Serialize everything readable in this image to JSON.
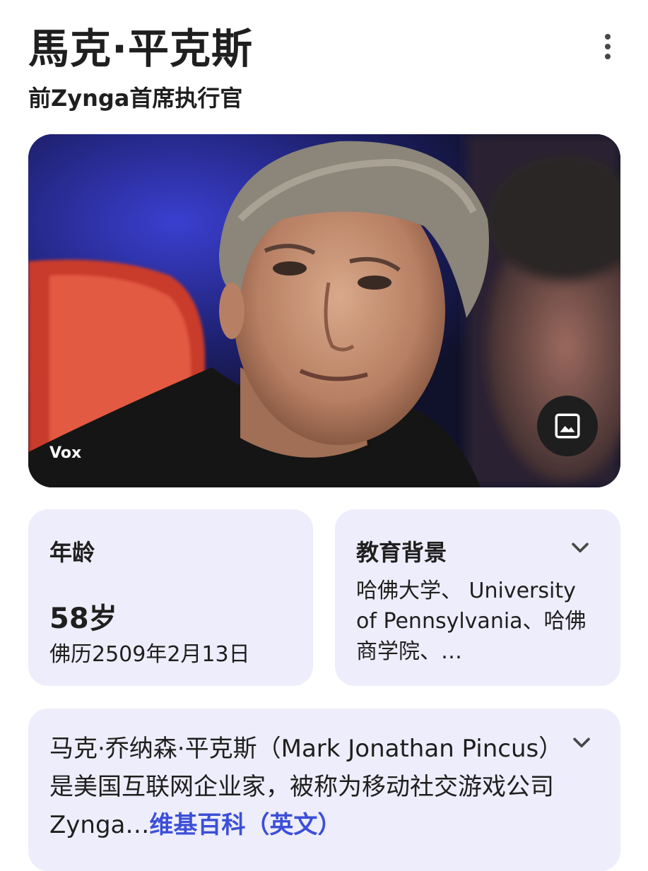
{
  "header": {
    "title": "馬克·平克斯",
    "subtitle": "前Zynga首席执行官",
    "more_icon": "more-vert-icon"
  },
  "hero": {
    "source": "Vox",
    "image_button_icon": "image-icon"
  },
  "age_card": {
    "label": "年龄",
    "value": "58岁",
    "date": "佛历2509年2月13日"
  },
  "education_card": {
    "label": "教育背景",
    "text": "哈佛大学、 University of Pennsylvania、哈佛商学院、…",
    "chevron_icon": "chevron-down-icon"
  },
  "description_card": {
    "text": "马克·乔纳森·平克斯（Mark Jonathan Pincus）是美国互联网企业家，被称为移动社交游戏公司Zynga…",
    "link": "维基百科（英文）",
    "chevron_icon": "chevron-down-icon"
  },
  "colors": {
    "card_bg": "#eeedfb",
    "link": "#3c4fd7",
    "text": "#1f1f1f"
  }
}
